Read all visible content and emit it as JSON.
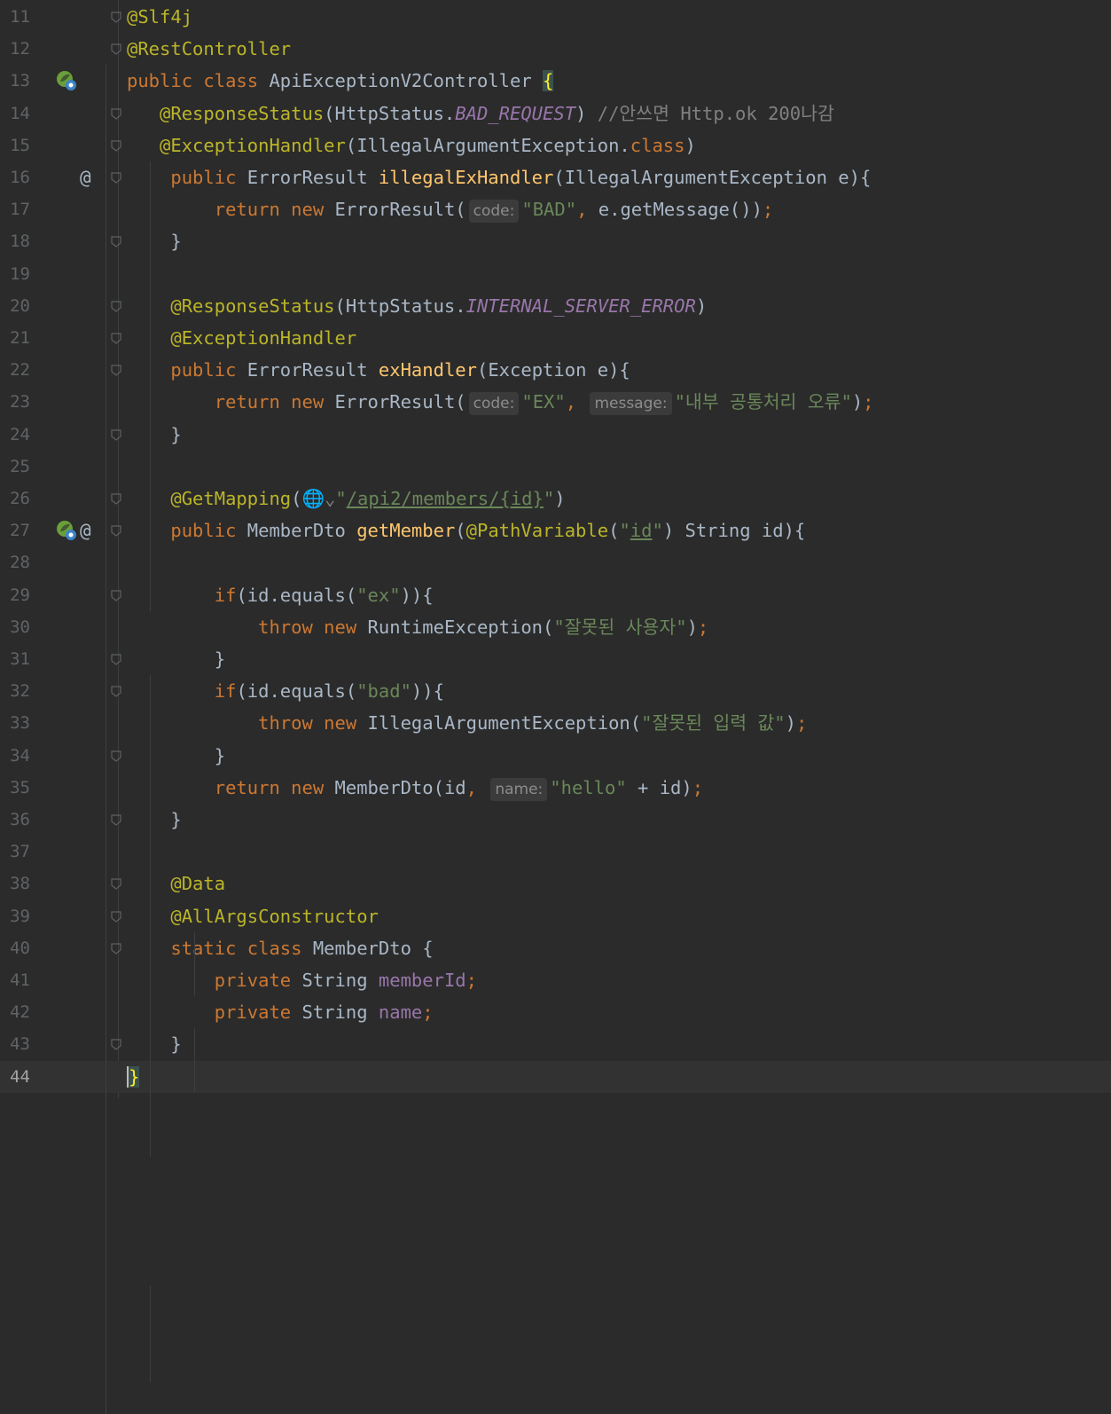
{
  "editor": {
    "lines": [
      {
        "n": "11",
        "segs": [
          {
            "t": "@Slf4j",
            "c": "an"
          }
        ]
      },
      {
        "n": "12",
        "segs": [
          {
            "t": "@RestController",
            "c": "an"
          }
        ]
      },
      {
        "n": "13",
        "segs": [
          {
            "t": "public ",
            "c": "kw"
          },
          {
            "t": "class ",
            "c": "kw"
          },
          {
            "t": "ApiExceptionV2Controller ",
            "c": ""
          },
          {
            "t": "{",
            "c": "bracehl"
          }
        ]
      },
      {
        "n": "14",
        "segs": [
          {
            "t": "   ",
            "c": ""
          },
          {
            "t": "@ResponseStatus",
            "c": "an"
          },
          {
            "t": "(HttpStatus.",
            "c": ""
          },
          {
            "t": "BAD_REQUEST",
            "c": "ital"
          },
          {
            "t": ") ",
            "c": ""
          },
          {
            "t": "//안쓰면 Http.ok 200나감",
            "c": "cmt"
          }
        ]
      },
      {
        "n": "15",
        "segs": [
          {
            "t": "   ",
            "c": ""
          },
          {
            "t": "@ExceptionHandler",
            "c": "an"
          },
          {
            "t": "(IllegalArgumentException.",
            "c": ""
          },
          {
            "t": "class",
            "c": "kw"
          },
          {
            "t": ")",
            "c": ""
          }
        ]
      },
      {
        "n": "16",
        "segs": [
          {
            "t": "    ",
            "c": ""
          },
          {
            "t": "public ",
            "c": "kw"
          },
          {
            "t": "ErrorResult ",
            "c": ""
          },
          {
            "t": "illegalExHandler",
            "c": "fn"
          },
          {
            "t": "(IllegalArgumentException e){",
            "c": ""
          }
        ]
      },
      {
        "n": "17",
        "segs": [
          {
            "t": "        ",
            "c": ""
          },
          {
            "t": "return ",
            "c": "kw"
          },
          {
            "t": "new ",
            "c": "kw"
          },
          {
            "t": "ErrorResult(",
            "c": ""
          },
          {
            "t": "code:",
            "c": "hint"
          },
          {
            "t": "\"BAD\"",
            "c": "str"
          },
          {
            "t": ", ",
            "c": "kw"
          },
          {
            "t": "e.getMessage())",
            "c": ""
          },
          {
            "t": ";",
            "c": "kw"
          }
        ]
      },
      {
        "n": "18",
        "segs": [
          {
            "t": "    }",
            "c": ""
          }
        ]
      },
      {
        "n": "19",
        "segs": []
      },
      {
        "n": "20",
        "segs": [
          {
            "t": "    ",
            "c": ""
          },
          {
            "t": "@ResponseStatus",
            "c": "an"
          },
          {
            "t": "(HttpStatus.",
            "c": ""
          },
          {
            "t": "INTERNAL_SERVER_ERROR",
            "c": "ital"
          },
          {
            "t": ")",
            "c": ""
          }
        ]
      },
      {
        "n": "21",
        "segs": [
          {
            "t": "    ",
            "c": ""
          },
          {
            "t": "@ExceptionHandler",
            "c": "an"
          }
        ]
      },
      {
        "n": "22",
        "segs": [
          {
            "t": "    ",
            "c": ""
          },
          {
            "t": "public ",
            "c": "kw"
          },
          {
            "t": "ErrorResult ",
            "c": ""
          },
          {
            "t": "exHandler",
            "c": "fn"
          },
          {
            "t": "(Exception e){",
            "c": ""
          }
        ]
      },
      {
        "n": "23",
        "segs": [
          {
            "t": "        ",
            "c": ""
          },
          {
            "t": "return ",
            "c": "kw"
          },
          {
            "t": "new ",
            "c": "kw"
          },
          {
            "t": "ErrorResult(",
            "c": ""
          },
          {
            "t": "code:",
            "c": "hint"
          },
          {
            "t": "\"EX\"",
            "c": "str"
          },
          {
            "t": ", ",
            "c": "kw"
          },
          {
            "t": "message:",
            "c": "hint"
          },
          {
            "t": "\"내부 공통처리 오류\"",
            "c": "str"
          },
          {
            "t": ")",
            "c": ""
          },
          {
            "t": ";",
            "c": "kw"
          }
        ]
      },
      {
        "n": "24",
        "segs": [
          {
            "t": "    }",
            "c": ""
          }
        ]
      },
      {
        "n": "25",
        "segs": []
      },
      {
        "n": "26",
        "segs": [
          {
            "t": "    ",
            "c": ""
          },
          {
            "t": "@GetMapping",
            "c": "an"
          },
          {
            "t": "(",
            "c": ""
          },
          {
            "t": "🌐⌄",
            "c": "cmt"
          },
          {
            "t": "\"",
            "c": "str"
          },
          {
            "t": "/api2/members/{id}",
            "c": "str und"
          },
          {
            "t": "\"",
            "c": "str"
          },
          {
            "t": ")",
            "c": ""
          }
        ]
      },
      {
        "n": "27",
        "segs": [
          {
            "t": "    ",
            "c": ""
          },
          {
            "t": "public ",
            "c": "kw"
          },
          {
            "t": "MemberDto ",
            "c": ""
          },
          {
            "t": "getMember",
            "c": "fn"
          },
          {
            "t": "(",
            "c": ""
          },
          {
            "t": "@PathVariable",
            "c": "an"
          },
          {
            "t": "(",
            "c": ""
          },
          {
            "t": "\"",
            "c": "str"
          },
          {
            "t": "id",
            "c": "str und"
          },
          {
            "t": "\"",
            "c": "str"
          },
          {
            "t": ") String id){",
            "c": ""
          }
        ]
      },
      {
        "n": "28",
        "segs": []
      },
      {
        "n": "29",
        "segs": [
          {
            "t": "        ",
            "c": ""
          },
          {
            "t": "if",
            "c": "kw"
          },
          {
            "t": "(id.equals(",
            "c": ""
          },
          {
            "t": "\"ex\"",
            "c": "str"
          },
          {
            "t": ")){",
            "c": ""
          }
        ]
      },
      {
        "n": "30",
        "segs": [
          {
            "t": "            ",
            "c": ""
          },
          {
            "t": "throw ",
            "c": "kw"
          },
          {
            "t": "new ",
            "c": "kw"
          },
          {
            "t": "RuntimeException(",
            "c": ""
          },
          {
            "t": "\"잘못된 사용자\"",
            "c": "str"
          },
          {
            "t": ")",
            "c": ""
          },
          {
            "t": ";",
            "c": "kw"
          }
        ]
      },
      {
        "n": "31",
        "segs": [
          {
            "t": "        }",
            "c": ""
          }
        ]
      },
      {
        "n": "32",
        "segs": [
          {
            "t": "        ",
            "c": ""
          },
          {
            "t": "if",
            "c": "kw"
          },
          {
            "t": "(id.equals(",
            "c": ""
          },
          {
            "t": "\"bad\"",
            "c": "str"
          },
          {
            "t": ")){",
            "c": ""
          }
        ]
      },
      {
        "n": "33",
        "segs": [
          {
            "t": "            ",
            "c": ""
          },
          {
            "t": "throw ",
            "c": "kw"
          },
          {
            "t": "new ",
            "c": "kw"
          },
          {
            "t": "IllegalArgumentException(",
            "c": ""
          },
          {
            "t": "\"잘못된 입력 값\"",
            "c": "str"
          },
          {
            "t": ")",
            "c": ""
          },
          {
            "t": ";",
            "c": "kw"
          }
        ]
      },
      {
        "n": "34",
        "segs": [
          {
            "t": "        }",
            "c": ""
          }
        ]
      },
      {
        "n": "35",
        "segs": [
          {
            "t": "        ",
            "c": ""
          },
          {
            "t": "return ",
            "c": "kw"
          },
          {
            "t": "new ",
            "c": "kw"
          },
          {
            "t": "MemberDto(id",
            "c": ""
          },
          {
            "t": ", ",
            "c": "kw"
          },
          {
            "t": "name:",
            "c": "hint"
          },
          {
            "t": "\"hello\"",
            "c": "str"
          },
          {
            "t": " + id)",
            "c": ""
          },
          {
            "t": ";",
            "c": "kw"
          }
        ]
      },
      {
        "n": "36",
        "segs": [
          {
            "t": "    }",
            "c": ""
          }
        ]
      },
      {
        "n": "37",
        "segs": []
      },
      {
        "n": "38",
        "segs": [
          {
            "t": "    ",
            "c": ""
          },
          {
            "t": "@Data",
            "c": "an"
          }
        ]
      },
      {
        "n": "39",
        "segs": [
          {
            "t": "    ",
            "c": ""
          },
          {
            "t": "@AllArgsConstructor",
            "c": "an"
          }
        ]
      },
      {
        "n": "40",
        "segs": [
          {
            "t": "    ",
            "c": ""
          },
          {
            "t": "static ",
            "c": "kw"
          },
          {
            "t": "class ",
            "c": "kw"
          },
          {
            "t": "MemberDto {",
            "c": ""
          }
        ]
      },
      {
        "n": "41",
        "segs": [
          {
            "t": "        ",
            "c": ""
          },
          {
            "t": "private ",
            "c": "kw"
          },
          {
            "t": "String ",
            "c": ""
          },
          {
            "t": "memberId",
            "c": "fld"
          },
          {
            "t": ";",
            "c": "kw"
          }
        ]
      },
      {
        "n": "42",
        "segs": [
          {
            "t": "        ",
            "c": ""
          },
          {
            "t": "private ",
            "c": "kw"
          },
          {
            "t": "String ",
            "c": ""
          },
          {
            "t": "name",
            "c": "fld"
          },
          {
            "t": ";",
            "c": "kw"
          }
        ]
      },
      {
        "n": "43",
        "segs": [
          {
            "t": "    }",
            "c": ""
          }
        ]
      },
      {
        "n": "44",
        "segs": [
          {
            "t": "}",
            "c": "bracehl caret"
          }
        ]
      }
    ],
    "gutter_icons": {
      "13": [
        "spring-bean-icon"
      ],
      "16": [
        "at-sign-icon"
      ],
      "27": [
        "spring-web-icon",
        "at-sign-icon"
      ]
    },
    "fold_lines": [
      "11",
      "12",
      "14",
      "15",
      "16",
      "18",
      "20",
      "21",
      "22",
      "24",
      "26",
      "27",
      "29",
      "31",
      "32",
      "34",
      "36",
      "38",
      "39",
      "40",
      "43"
    ],
    "current_line": "44",
    "colors": {
      "background": "#2b2b2b",
      "keyword": "#cc7832",
      "annotation": "#bbb529",
      "string": "#6a8759",
      "comment": "#808080",
      "field": "#9876aa",
      "method": "#ffc66d",
      "text": "#a9b7c6"
    }
  }
}
